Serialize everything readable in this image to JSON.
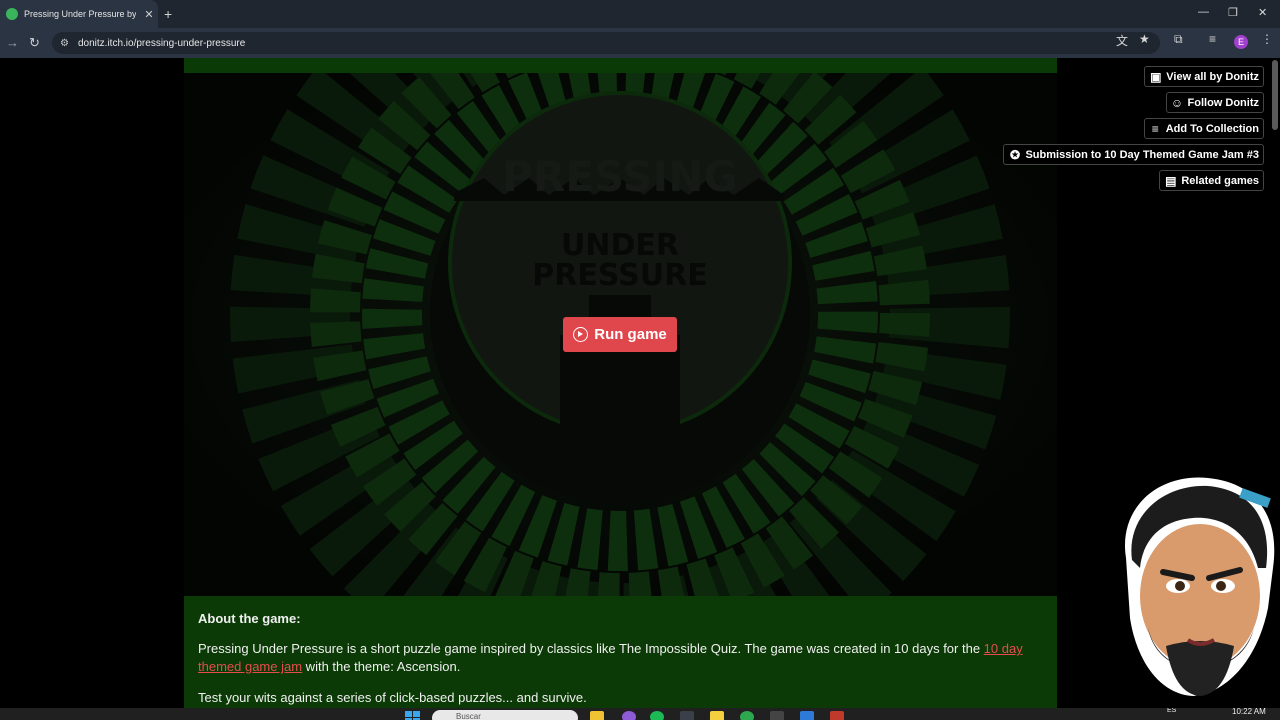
{
  "browser": {
    "tab_title": "Pressing Under Pressure by Donitz",
    "new_tab": "+",
    "close_tab": "✕",
    "url": "donitz.itch.io/pressing-under-pressure",
    "profile_initial": "E",
    "window_controls": {
      "minimize": "—",
      "maximize": "❐",
      "close": "✕"
    }
  },
  "game": {
    "cover_title_top": "PRESSING",
    "cover_title_middle": "UNDER",
    "cover_title_bottom": "PRESSURE",
    "run_label": "Run game"
  },
  "sidebar": {
    "buttons": [
      {
        "label": "View all by Donitz",
        "icon": "controller-icon"
      },
      {
        "label": "Follow Donitz",
        "icon": "person-plus-icon"
      },
      {
        "label": "Add To Collection",
        "icon": "list-plus-icon"
      },
      {
        "label": "Submission to 10 Day Themed Game Jam #3",
        "icon": "award-icon"
      },
      {
        "label": "Related games",
        "icon": "map-icon"
      }
    ]
  },
  "description": {
    "heading": "About the game:",
    "para1_before": "Pressing Under Pressure is a short puzzle game inspired by classics like The Impossible Quiz. The game was created in 10 days for the ",
    "para1_link": "10 day themed game jam",
    "para1_after": " with the theme: Ascension.",
    "para2": "Test your wits against a series of click-based puzzles... and survive."
  },
  "taskbar": {
    "search_placeholder": "Buscar",
    "language": "ES",
    "time": "10:22 AM"
  },
  "colors": {
    "accent": "#e0474c",
    "panel_green": "#0b3a06",
    "link": "#e54d4d"
  }
}
